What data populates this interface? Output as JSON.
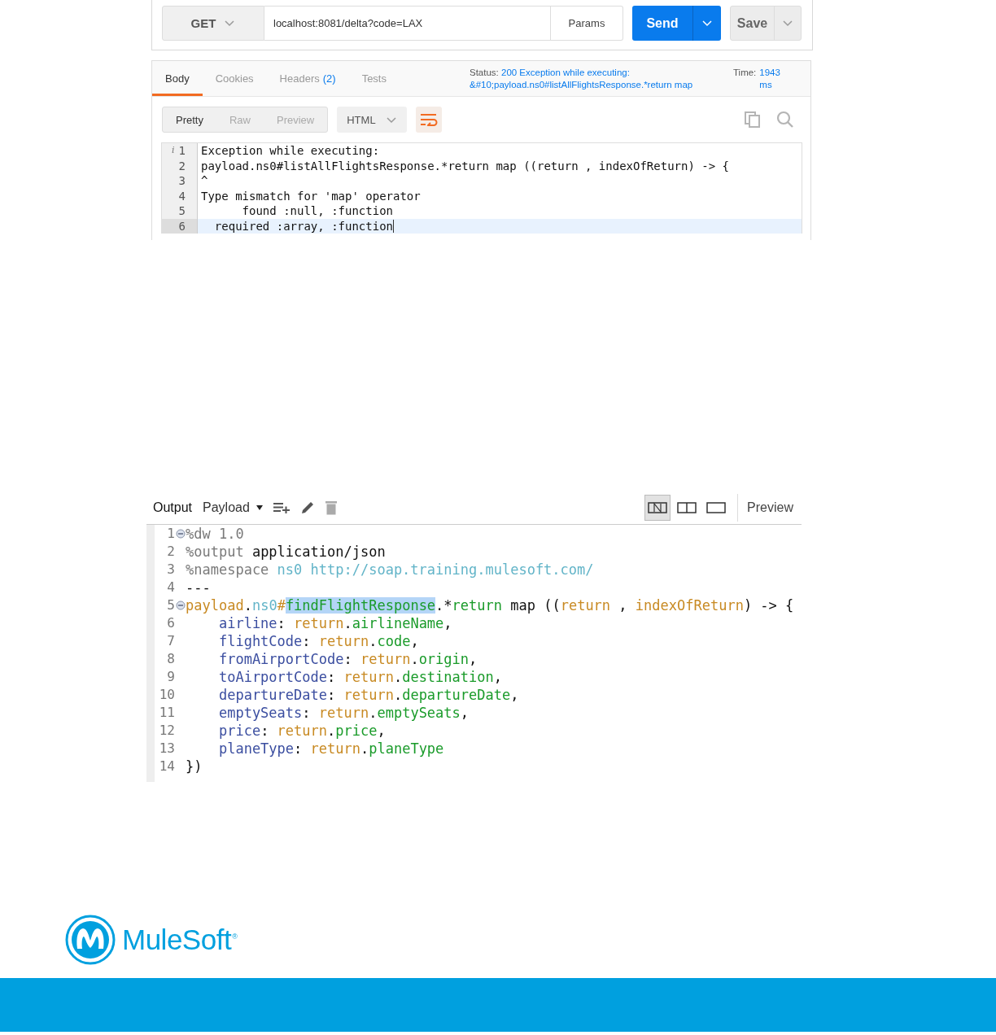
{
  "request_bar": {
    "method": "GET",
    "url": "localhost:8081/delta?code=LAX",
    "params_button": "Params",
    "send_button": "Send",
    "save_button": "Save"
  },
  "response": {
    "tabs": [
      {
        "label": "Body",
        "selected": true
      },
      {
        "label": "Cookies",
        "selected": false
      },
      {
        "label": "Headers",
        "count": "(2)",
        "selected": false
      },
      {
        "label": "Tests",
        "selected": false
      }
    ],
    "status_label": "Status:",
    "status_value": "200 Exception while executing: &#10;payload.ns0#listAllFlightsResponse.*return map",
    "time_label": "Time:",
    "time_value": "1943 ms",
    "view_modes": [
      {
        "label": "Pretty",
        "selected": true
      },
      {
        "label": "Raw",
        "selected": false
      },
      {
        "label": "Preview",
        "selected": false
      }
    ],
    "format": "HTML",
    "wrap_on": true,
    "lines": [
      {
        "number": "1",
        "mark": "i",
        "text": "Exception while executing:",
        "active": false
      },
      {
        "number": "2",
        "text": "payload.ns0#listAllFlightsResponse.*return map ((return , indexOfReturn) -> {",
        "active": false
      },
      {
        "number": "3",
        "text": "^",
        "active": false
      },
      {
        "number": "4",
        "text": "Type mismatch for 'map' operator",
        "active": false
      },
      {
        "number": "5",
        "text": "      found :null, :function",
        "active": false
      },
      {
        "number": "6",
        "text": "  required :array, :function",
        "active": true
      }
    ]
  },
  "output_editor": {
    "output_label": "Output",
    "target": "Payload",
    "layouts": [
      {
        "kind": "source",
        "selected": true
      },
      {
        "kind": "split",
        "selected": false
      },
      {
        "kind": "single",
        "selected": false
      }
    ],
    "preview_label": "Preview",
    "lines": [
      {
        "number": "1",
        "foldable": true,
        "tokens": [
          {
            "text": "%dw 1.0",
            "kind": "directive"
          }
        ]
      },
      {
        "number": "2",
        "foldable": false,
        "tokens": [
          {
            "text": "%output",
            "kind": "directive"
          },
          {
            "text": " application/json",
            "kind": "plain"
          }
        ]
      },
      {
        "number": "3",
        "foldable": false,
        "tokens": [
          {
            "text": "%namespace",
            "kind": "directive"
          },
          {
            "text": " ns0 http://soap.training.mulesoft.com/",
            "kind": "ns"
          }
        ]
      },
      {
        "number": "4",
        "foldable": false,
        "tokens": [
          {
            "text": "---",
            "kind": "plain"
          }
        ]
      },
      {
        "number": "5",
        "foldable": true,
        "tokens": [
          {
            "text": "payload",
            "kind": "ret"
          },
          {
            "text": ".",
            "kind": "plain"
          },
          {
            "text": "ns0",
            "kind": "ns"
          },
          {
            "text": "#",
            "kind": "ret"
          },
          {
            "text": "findFlightResponse",
            "kind": "selection"
          },
          {
            "text": ".*",
            "kind": "plain"
          },
          {
            "text": "return",
            "kind": "field"
          },
          {
            "text": " map ((",
            "kind": "plain"
          },
          {
            "text": "return",
            "kind": "ret"
          },
          {
            "text": " , ",
            "kind": "plain"
          },
          {
            "text": "indexOfReturn",
            "kind": "ret"
          },
          {
            "text": ") -> {",
            "kind": "plain"
          }
        ]
      },
      {
        "number": "6",
        "foldable": false,
        "tokens": [
          {
            "text": "    airline",
            "kind": "key"
          },
          {
            "text": ": ",
            "kind": "plain"
          },
          {
            "text": "return",
            "kind": "ret"
          },
          {
            "text": ".",
            "kind": "plain"
          },
          {
            "text": "airlineName",
            "kind": "field"
          },
          {
            "text": ",",
            "kind": "plain"
          }
        ]
      },
      {
        "number": "7",
        "foldable": false,
        "tokens": [
          {
            "text": "    flightCode",
            "kind": "key"
          },
          {
            "text": ": ",
            "kind": "plain"
          },
          {
            "text": "return",
            "kind": "ret"
          },
          {
            "text": ".",
            "kind": "plain"
          },
          {
            "text": "code",
            "kind": "field"
          },
          {
            "text": ",",
            "kind": "plain"
          }
        ]
      },
      {
        "number": "8",
        "foldable": false,
        "tokens": [
          {
            "text": "    fromAirportCode",
            "kind": "key"
          },
          {
            "text": ": ",
            "kind": "plain"
          },
          {
            "text": "return",
            "kind": "ret"
          },
          {
            "text": ".",
            "kind": "plain"
          },
          {
            "text": "origin",
            "kind": "field"
          },
          {
            "text": ",",
            "kind": "plain"
          }
        ]
      },
      {
        "number": "9",
        "foldable": false,
        "tokens": [
          {
            "text": "    toAirportCode",
            "kind": "key"
          },
          {
            "text": ": ",
            "kind": "plain"
          },
          {
            "text": "return",
            "kind": "ret"
          },
          {
            "text": ".",
            "kind": "plain"
          },
          {
            "text": "destination",
            "kind": "field"
          },
          {
            "text": ",",
            "kind": "plain"
          }
        ]
      },
      {
        "number": "10",
        "foldable": false,
        "tokens": [
          {
            "text": "    departureDate",
            "kind": "key"
          },
          {
            "text": ": ",
            "kind": "plain"
          },
          {
            "text": "return",
            "kind": "ret"
          },
          {
            "text": ".",
            "kind": "plain"
          },
          {
            "text": "departureDate",
            "kind": "field"
          },
          {
            "text": ",",
            "kind": "plain"
          }
        ]
      },
      {
        "number": "11",
        "foldable": false,
        "tokens": [
          {
            "text": "    emptySeats",
            "kind": "key"
          },
          {
            "text": ": ",
            "kind": "plain"
          },
          {
            "text": "return",
            "kind": "ret"
          },
          {
            "text": ".",
            "kind": "plain"
          },
          {
            "text": "emptySeats",
            "kind": "field"
          },
          {
            "text": ",",
            "kind": "plain"
          }
        ]
      },
      {
        "number": "12",
        "foldable": false,
        "tokens": [
          {
            "text": "    price",
            "kind": "key"
          },
          {
            "text": ": ",
            "kind": "plain"
          },
          {
            "text": "return",
            "kind": "ret"
          },
          {
            "text": ".",
            "kind": "plain"
          },
          {
            "text": "price",
            "kind": "field"
          },
          {
            "text": ",",
            "kind": "plain"
          }
        ]
      },
      {
        "number": "13",
        "foldable": false,
        "tokens": [
          {
            "text": "    planeType",
            "kind": "key"
          },
          {
            "text": ": ",
            "kind": "plain"
          },
          {
            "text": "return",
            "kind": "ret"
          },
          {
            "text": ".",
            "kind": "plain"
          },
          {
            "text": "planeType",
            "kind": "field"
          }
        ]
      },
      {
        "number": "14",
        "foldable": false,
        "tokens": [
          {
            "text": "})",
            "kind": "plain"
          }
        ]
      }
    ]
  },
  "footer": {
    "logo_text": "MuleSoft",
    "registered_mark": "®"
  }
}
